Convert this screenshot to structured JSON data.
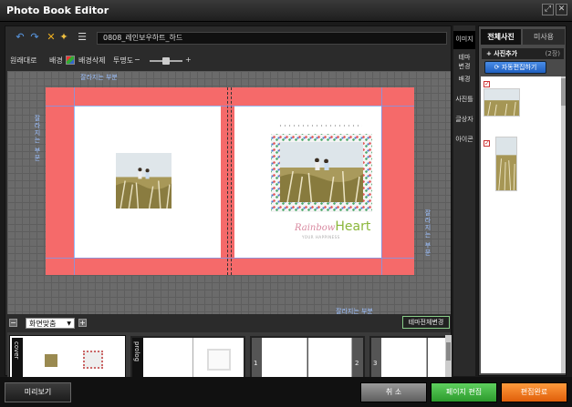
{
  "window": {
    "title": "Photo Book Editor",
    "restore_icon": "restore-icon",
    "close_icon": "close-icon"
  },
  "toolbar": {
    "filename": "0808_레인보우하트_하드",
    "icons": [
      "undo-icon",
      "redo-icon",
      "delete-icon",
      "tools-icon",
      "align-icon"
    ]
  },
  "toolbar2": {
    "restore_label": "원래대로",
    "background_label": "배경",
    "remove_background_label": "배경삭제",
    "opacity_label": "투명도",
    "opacity_level": 0.5
  },
  "canvas": {
    "cut_top": "잘라지는 부분",
    "cut_left": "잘라지는 부분",
    "cut_right": "잘라지는 부분",
    "cut_bottom": "잘라지는 부분",
    "logo_script": "Rainbow",
    "logo_word": "Heart",
    "logo_sub": "YOUR HAPPINESS"
  },
  "zoom": {
    "value": "화면맞춤",
    "minus": "−",
    "plus": "+",
    "theme_change": "테마전체변경"
  },
  "thumbnails": {
    "cover_label": "cover",
    "prolog_label": "prolog",
    "page_numbers": [
      "1",
      "2",
      "3"
    ]
  },
  "side_tabs": [
    "이미지",
    "테마변경",
    "배경",
    "사진틀",
    "글상자",
    "아이콘"
  ],
  "right_panel": {
    "tab_all": "전체사진",
    "tab_unused": "미사용",
    "add_photo": "+ 사진추가",
    "count": "(2장)",
    "auto_edit": "자동편집하기",
    "check": "✓"
  },
  "bottom": {
    "preview": "미리보기",
    "cancel": "취 소",
    "page_edit": "페이지 편집",
    "done": "편집완료"
  },
  "colors": {
    "bleed": "#f56a6a",
    "page_edit": "#2c9a2c",
    "done": "#e05e0a",
    "auto_edit": "#1f5fc0"
  }
}
